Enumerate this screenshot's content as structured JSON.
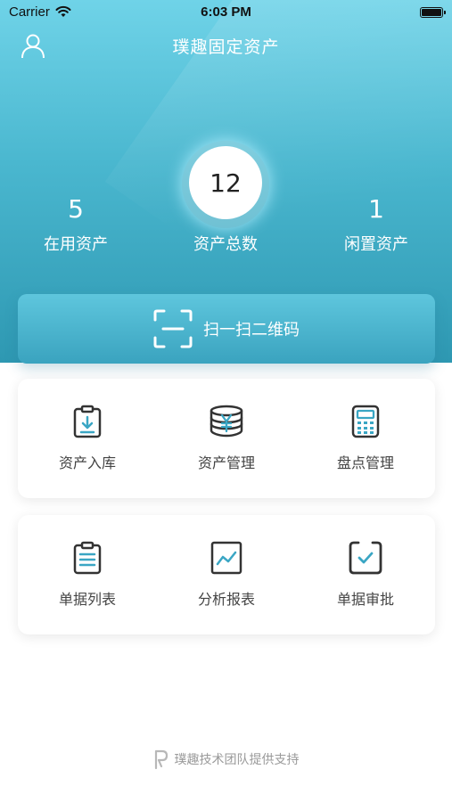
{
  "status_bar": {
    "carrier": "Carrier",
    "time": "6:03 PM"
  },
  "header": {
    "title": "璞趣固定资产",
    "user_icon": "user-icon"
  },
  "stats": {
    "in_use": {
      "value": "5",
      "label": "在用资产"
    },
    "total": {
      "value": "12",
      "label": "资产总数"
    },
    "idle": {
      "value": "1",
      "label": "闲置资产"
    }
  },
  "scan": {
    "label": "扫一扫二维码",
    "icon": "qr-scan-icon"
  },
  "menu_rows": [
    [
      {
        "label": "资产入库",
        "icon": "clipboard-in-icon"
      },
      {
        "label": "资产管理",
        "icon": "yen-coins-icon"
      },
      {
        "label": "盘点管理",
        "icon": "calculator-icon"
      }
    ],
    [
      {
        "label": "单据列表",
        "icon": "list-clipboard-icon"
      },
      {
        "label": "分析报表",
        "icon": "chart-icon"
      },
      {
        "label": "单据审批",
        "icon": "approve-check-icon"
      }
    ]
  ],
  "footer": {
    "text": "璞趣技术团队提供支持",
    "logo": "puqu-logo-icon"
  },
  "colors": {
    "accent": "#4ab7cf",
    "icon_accent": "#3aa6c4",
    "icon_stroke": "#333333"
  }
}
